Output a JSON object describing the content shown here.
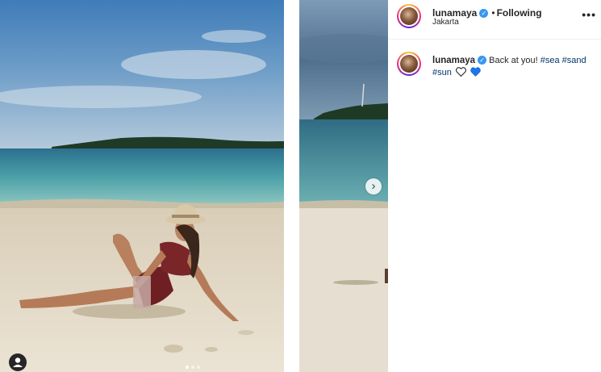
{
  "post": {
    "username": "lunamaya",
    "location": "Jakarta",
    "separator": "•",
    "follow_status": "Following",
    "more_options": "•••",
    "next_arrow": "›",
    "carousel": {
      "count": 3,
      "active_index": 0
    },
    "caption": {
      "username": "lunamaya",
      "text": "Back at you!",
      "hashtags": [
        "#sea",
        "#sand",
        "#sun"
      ],
      "emojis": [
        "white-heart",
        "blue-heart"
      ]
    }
  },
  "colors": {
    "accent_link": "#00376b",
    "verified_badge": "#3897f0",
    "text": "#262626"
  }
}
